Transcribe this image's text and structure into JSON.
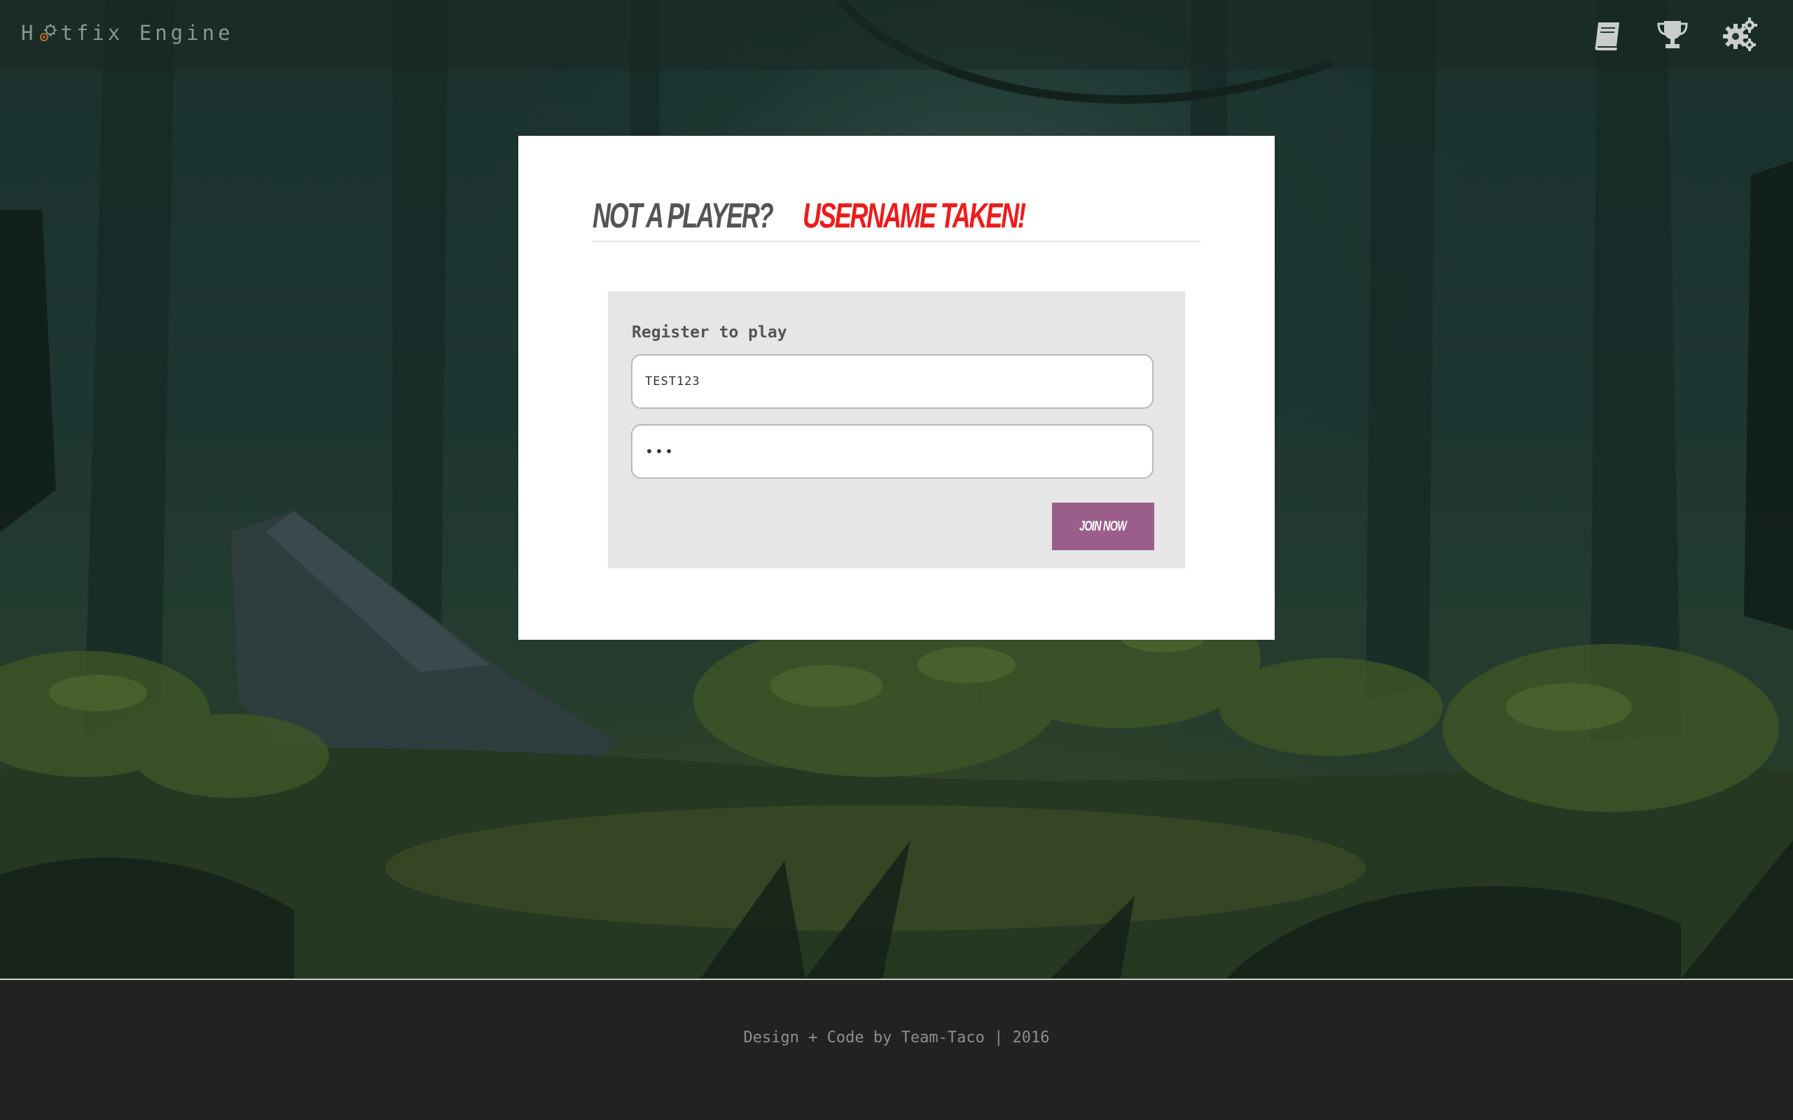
{
  "app": {
    "brand_prefix": "H",
    "brand_suffix": "tfix Engine",
    "brand_text": "Hotfix Engine",
    "brand_gear_icon": "gear-icon"
  },
  "nav": {
    "items": [
      {
        "icon": "book-icon"
      },
      {
        "icon": "trophy-icon"
      },
      {
        "icon": "settings-gears-icon"
      }
    ]
  },
  "register": {
    "heading": "Not a player?",
    "error": "Username taken!",
    "form_title": "Register to play",
    "username_value": "TEST123",
    "password_value": "•••",
    "submit_label": "Join now"
  },
  "footer": {
    "text": "Design + Code by Team-Taco | 2016"
  },
  "colors": {
    "error": "#ee1b1b",
    "button": "#9b5e8a",
    "heading": "#555555"
  }
}
